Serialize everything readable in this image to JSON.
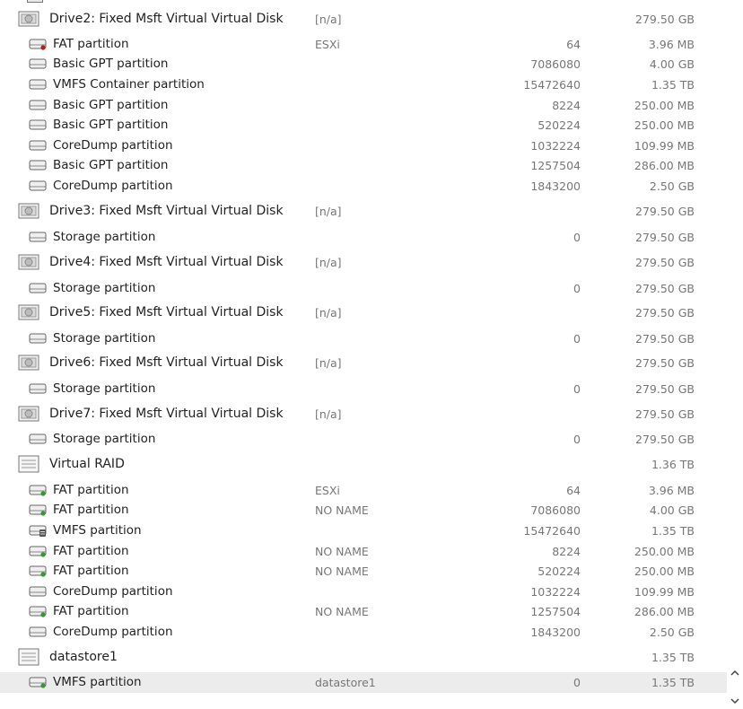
{
  "rows": [
    {
      "kind": "disk",
      "icon": "drive-icon",
      "name": "Drive2: Fixed Msft Virtual Virtual Disk",
      "label": "[n/a]",
      "offset": "",
      "size": "279.50 GB"
    },
    {
      "kind": "part",
      "icon": "partition-red-icon",
      "name": "FAT partition",
      "label": "ESXi",
      "offset": "64",
      "size": "3.96 MB"
    },
    {
      "kind": "part",
      "icon": "partition-icon",
      "name": "Basic GPT partition",
      "label": "",
      "offset": "7086080",
      "size": "4.00 GB"
    },
    {
      "kind": "part",
      "icon": "partition-icon",
      "name": "VMFS Container partition",
      "label": "",
      "offset": "15472640",
      "size": "1.35 TB"
    },
    {
      "kind": "part",
      "icon": "partition-icon",
      "name": "Basic GPT partition",
      "label": "",
      "offset": "8224",
      "size": "250.00 MB"
    },
    {
      "kind": "part",
      "icon": "partition-icon",
      "name": "Basic GPT partition",
      "label": "",
      "offset": "520224",
      "size": "250.00 MB"
    },
    {
      "kind": "part",
      "icon": "partition-icon",
      "name": "CoreDump partition",
      "label": "",
      "offset": "1032224",
      "size": "109.99 MB"
    },
    {
      "kind": "part",
      "icon": "partition-icon",
      "name": "Basic GPT partition",
      "label": "",
      "offset": "1257504",
      "size": "286.00 MB"
    },
    {
      "kind": "part",
      "icon": "partition-icon",
      "name": "CoreDump partition",
      "label": "",
      "offset": "1843200",
      "size": "2.50 GB"
    },
    {
      "kind": "disk",
      "icon": "drive-icon",
      "name": "Drive3: Fixed Msft Virtual Virtual Disk",
      "label": "[n/a]",
      "offset": "",
      "size": "279.50 GB"
    },
    {
      "kind": "part",
      "icon": "partition-icon",
      "name": "Storage partition",
      "label": "",
      "offset": "0",
      "size": "279.50 GB"
    },
    {
      "kind": "disk",
      "icon": "drive-icon",
      "name": "Drive4: Fixed Msft Virtual Virtual Disk",
      "label": "[n/a]",
      "offset": "",
      "size": "279.50 GB"
    },
    {
      "kind": "part",
      "icon": "partition-icon",
      "name": "Storage partition",
      "label": "",
      "offset": "0",
      "size": "279.50 GB"
    },
    {
      "kind": "disk",
      "icon": "drive-icon",
      "name": "Drive5: Fixed Msft Virtual Virtual Disk",
      "label": "[n/a]",
      "offset": "",
      "size": "279.50 GB"
    },
    {
      "kind": "part",
      "icon": "partition-icon",
      "name": "Storage partition",
      "label": "",
      "offset": "0",
      "size": "279.50 GB"
    },
    {
      "kind": "disk",
      "icon": "drive-icon",
      "name": "Drive6: Fixed Msft Virtual Virtual Disk",
      "label": "[n/a]",
      "offset": "",
      "size": "279.50 GB"
    },
    {
      "kind": "part",
      "icon": "partition-icon",
      "name": "Storage partition",
      "label": "",
      "offset": "0",
      "size": "279.50 GB"
    },
    {
      "kind": "disk",
      "icon": "drive-icon",
      "name": "Drive7: Fixed Msft Virtual Virtual Disk",
      "label": "[n/a]",
      "offset": "",
      "size": "279.50 GB"
    },
    {
      "kind": "part",
      "icon": "partition-icon",
      "name": "Storage partition",
      "label": "",
      "offset": "0",
      "size": "279.50 GB"
    },
    {
      "kind": "disk",
      "icon": "raid-icon",
      "name": "Virtual RAID",
      "label": "",
      "offset": "",
      "size": "1.36 TB"
    },
    {
      "kind": "part",
      "icon": "partition-green-icon",
      "name": "FAT partition",
      "label": "ESXi",
      "offset": "64",
      "size": "3.96 MB"
    },
    {
      "kind": "part",
      "icon": "partition-green-icon",
      "name": "FAT partition",
      "label": "NO NAME",
      "offset": "7086080",
      "size": "4.00 GB"
    },
    {
      "kind": "part",
      "icon": "vmfs-partition-icon",
      "name": "VMFS partition",
      "label": "",
      "offset": "15472640",
      "size": "1.35 TB"
    },
    {
      "kind": "part",
      "icon": "partition-green-icon",
      "name": "FAT partition",
      "label": "NO NAME",
      "offset": "8224",
      "size": "250.00 MB"
    },
    {
      "kind": "part",
      "icon": "partition-green-icon",
      "name": "FAT partition",
      "label": "NO NAME",
      "offset": "520224",
      "size": "250.00 MB"
    },
    {
      "kind": "part",
      "icon": "partition-icon",
      "name": "CoreDump partition",
      "label": "",
      "offset": "1032224",
      "size": "109.99 MB"
    },
    {
      "kind": "part",
      "icon": "partition-green-icon",
      "name": "FAT partition",
      "label": "NO NAME",
      "offset": "1257504",
      "size": "286.00 MB"
    },
    {
      "kind": "part",
      "icon": "partition-icon",
      "name": "CoreDump partition",
      "label": "",
      "offset": "1843200",
      "size": "2.50 GB"
    },
    {
      "kind": "disk",
      "icon": "raid-icon",
      "name": "datastore1",
      "label": "",
      "offset": "",
      "size": "1.35 TB"
    },
    {
      "kind": "part",
      "icon": "partition-green-icon",
      "name": "VMFS partition",
      "label": "datastore1",
      "offset": "0",
      "size": "1.35 TB",
      "selected": true
    }
  ],
  "scrollbar": {
    "up_icon": "chevron-up-icon",
    "down_icon": "chevron-down-icon"
  }
}
